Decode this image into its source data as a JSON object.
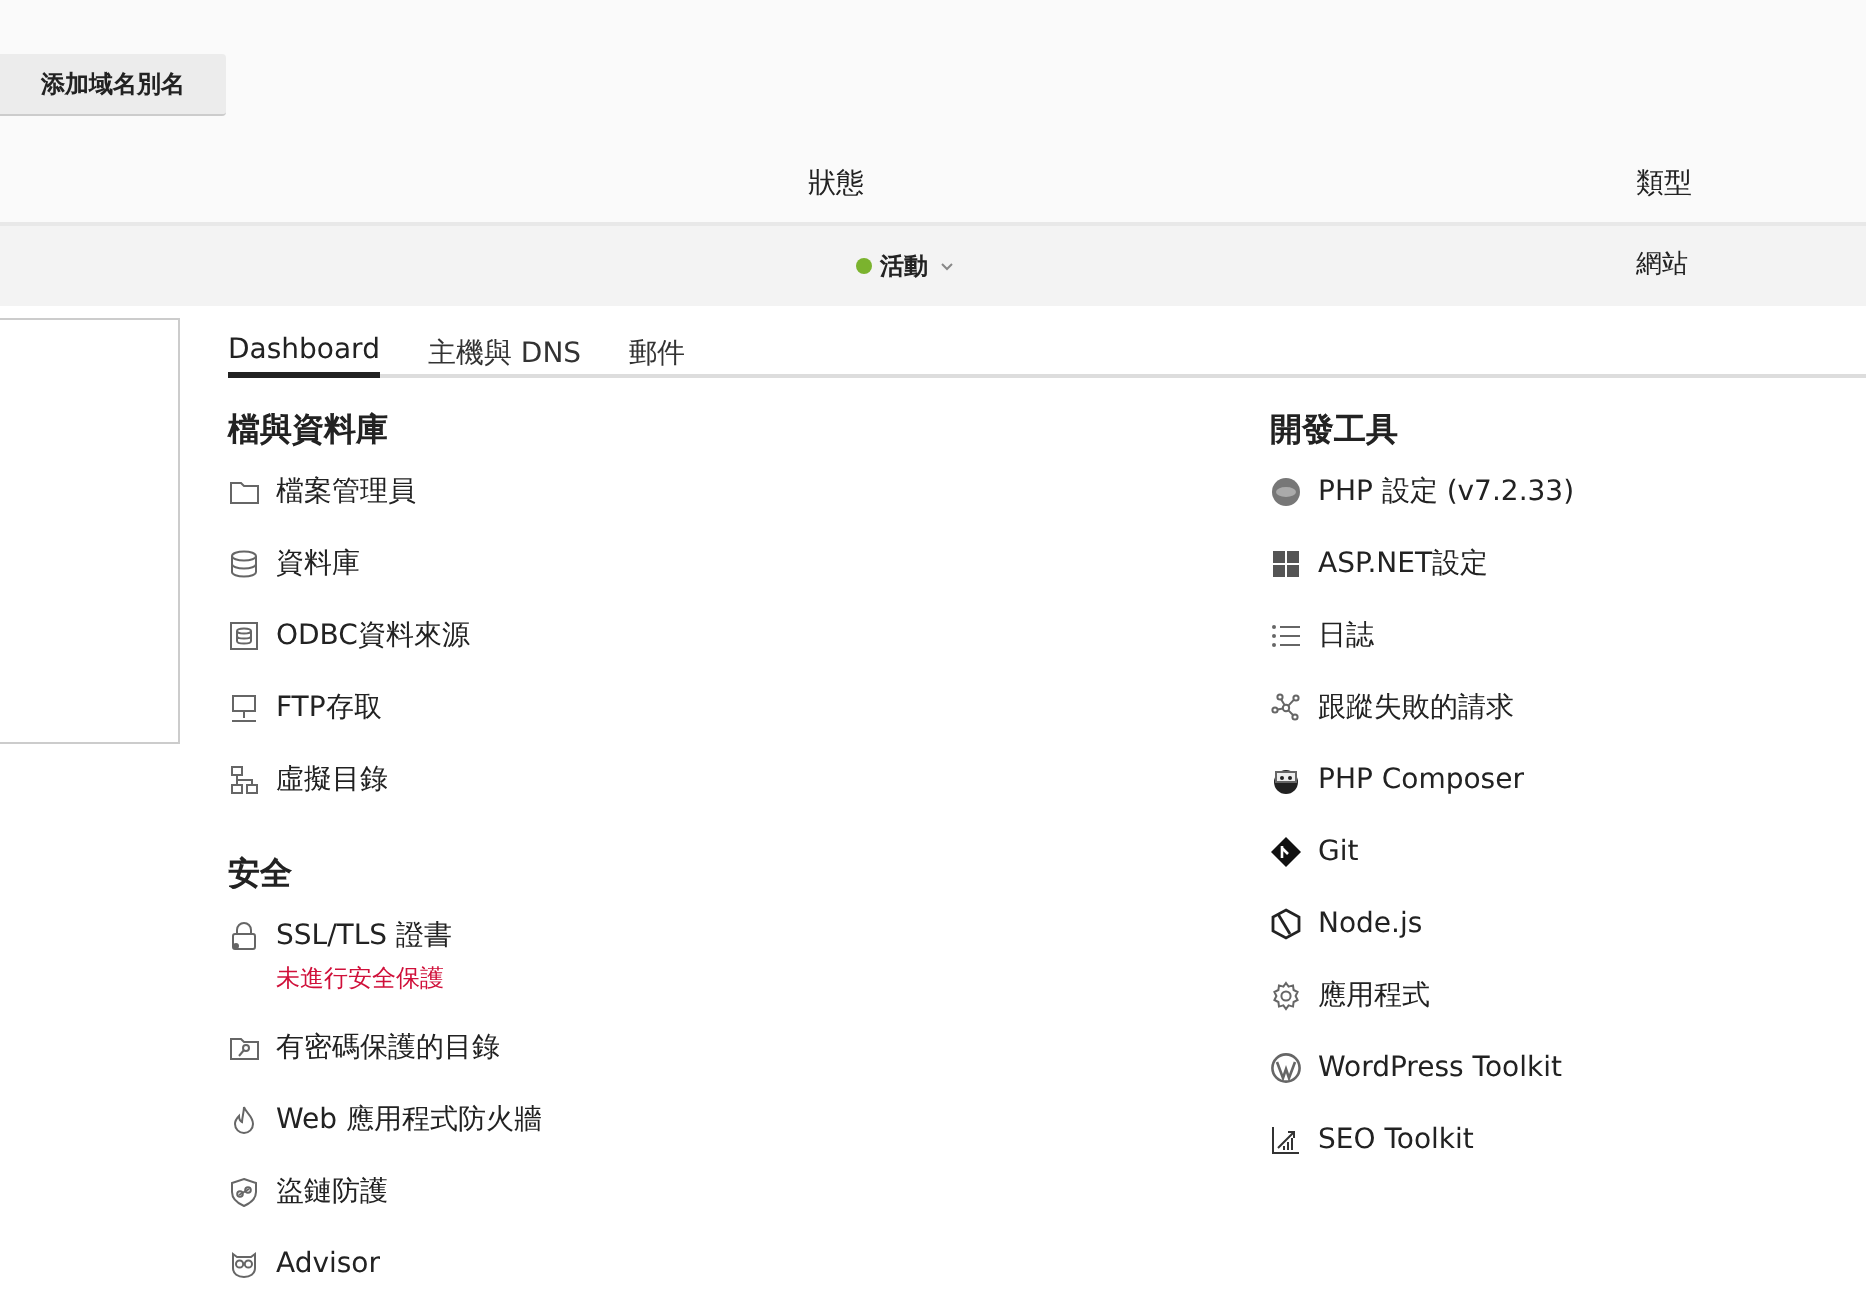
{
  "toolbar": {
    "button": "添加域名別名"
  },
  "table": {
    "columns": [
      {
        "label": "狀態"
      },
      {
        "label": "類型"
      }
    ],
    "row": {
      "status": "活動",
      "type": "網站"
    }
  },
  "tabs": [
    {
      "label": "Dashboard",
      "selected": true
    },
    {
      "label": "主機與 DNS",
      "selected": false
    },
    {
      "label": "郵件",
      "selected": false
    }
  ],
  "columns": [
    {
      "sections": [
        {
          "title": "檔與資料庫",
          "items": [
            {
              "label": "檔案管理員"
            },
            {
              "label": "資料庫"
            },
            {
              "label": "ODBC資料來源"
            },
            {
              "label": "FTP存取"
            },
            {
              "label": "虛擬目錄"
            }
          ]
        },
        {
          "title": "安全",
          "items": [
            {
              "label": "SSL/TLS 證書",
              "warning": "未進行安全保護"
            },
            {
              "label": "有密碼保護的目錄"
            },
            {
              "label": "Web 應用程式防火牆"
            },
            {
              "label": "盜鏈防護"
            },
            {
              "label": "Advisor"
            }
          ]
        }
      ]
    },
    {
      "sections": [
        {
          "title": "開發工具",
          "items": [
            {
              "label": "PHP 設定 (v7.2.33)"
            },
            {
              "label": "ASP.NET設定"
            },
            {
              "label": "日誌"
            },
            {
              "label": "跟蹤失敗的請求"
            },
            {
              "label": "PHP Composer"
            },
            {
              "label": "Git"
            },
            {
              "label": "Node.js"
            },
            {
              "label": "應用程式"
            },
            {
              "label": "WordPress Toolkit"
            },
            {
              "label": "SEO Toolkit"
            }
          ]
        }
      ]
    }
  ]
}
